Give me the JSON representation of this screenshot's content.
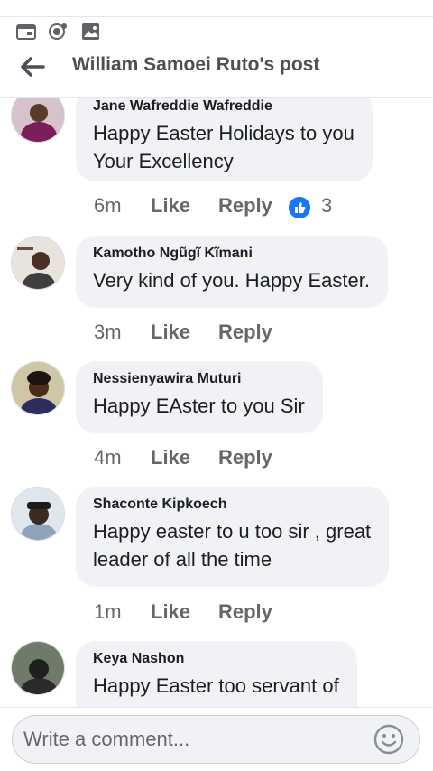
{
  "header": {
    "title": "William Samoei Ruto's post"
  },
  "status_icons": [
    "calendar-icon",
    "messenger-icon",
    "gallery-icon"
  ],
  "comments": [
    {
      "author": "Jane Wafreddie Wafreddie",
      "lines": [
        "Happy Easter Holidays to you",
        "Your Excellency"
      ],
      "time": "6m",
      "like": "Like",
      "reply": "Reply",
      "reactions": "3"
    },
    {
      "author": "Kamotho Ngũgĩ Kĩmani",
      "lines": [
        "Very kind of you. Happy Easter."
      ],
      "time": "3m",
      "like": "Like",
      "reply": "Reply"
    },
    {
      "author": "Nessienyawira Muturi",
      "lines": [
        "Happy EAster to you Sir"
      ],
      "time": "4m",
      "like": "Like",
      "reply": "Reply"
    },
    {
      "author": "Shaconte Kipkoech",
      "lines": [
        "Happy easter to u too sir , great",
        "leader of all the time"
      ],
      "time": "1m",
      "like": "Like",
      "reply": "Reply"
    },
    {
      "author": "Keya Nashon",
      "lines": [
        "Happy Easter too servant of"
      ]
    }
  ],
  "composer": {
    "placeholder": "Write a comment..."
  },
  "colors": {
    "accent": "#1877f2",
    "bubble": "#f0f2f5",
    "muted": "#65676b"
  }
}
